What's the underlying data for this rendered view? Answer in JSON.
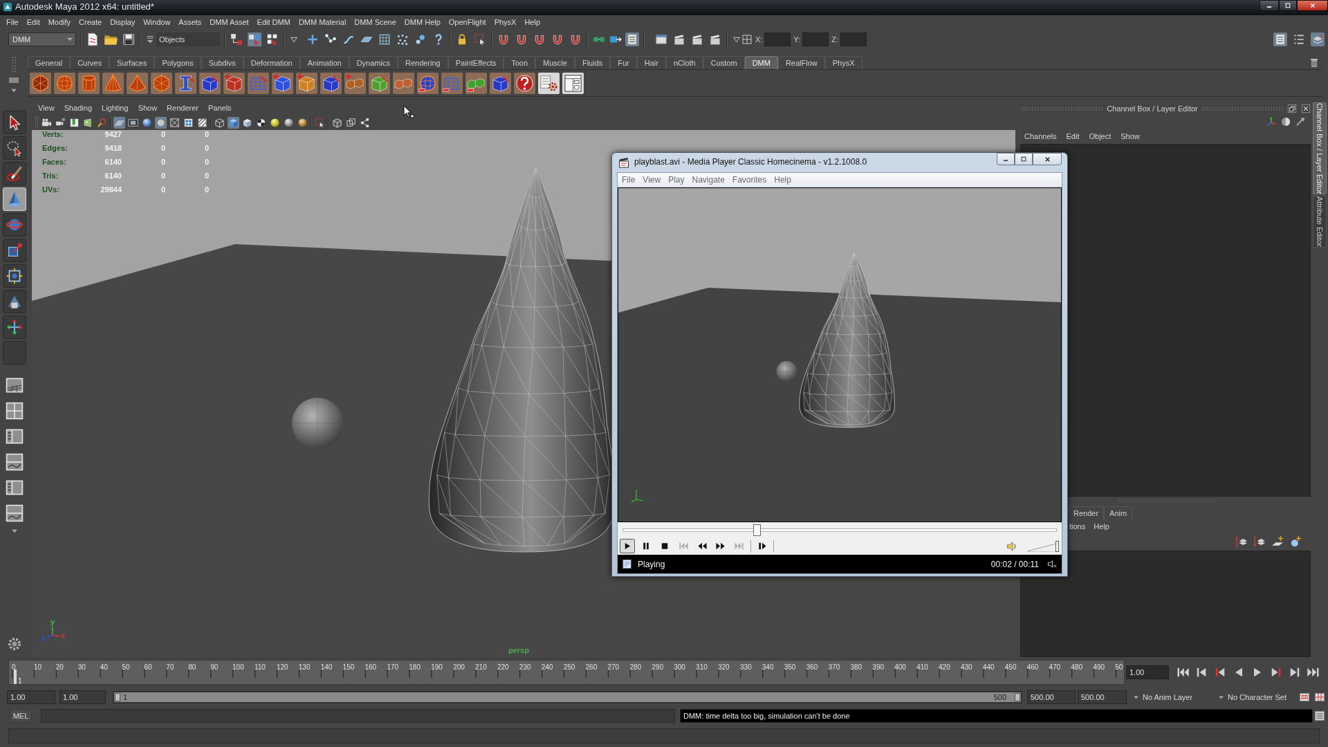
{
  "window": {
    "title": "Autodesk Maya 2012 x64: untitled*"
  },
  "menu_bar": [
    "File",
    "Edit",
    "Modify",
    "Create",
    "Display",
    "Window",
    "Assets",
    "DMM Asset",
    "Edit DMM",
    "DMM Material",
    "DMM Scene",
    "DMM Help",
    "OpenFlight",
    "PhysX",
    "Help"
  ],
  "status_line": {
    "menu_set": "DMM",
    "selection_mode": "Objects",
    "buttons": [
      {
        "on": false
      },
      {
        "on": true
      },
      {
        "on": false
      },
      {
        "on": false
      },
      {
        "on": false
      },
      {
        "on": false
      },
      {
        "on": false
      },
      {
        "on": false
      },
      {
        "on": false
      },
      {
        "on": false
      },
      {
        "on": false
      },
      {
        "on": false
      },
      {
        "on": false
      },
      {
        "on": false
      },
      {
        "on": false
      },
      {
        "on": false
      },
      {
        "on": false
      },
      {
        "on": false
      },
      {
        "on": false
      },
      {
        "on": false
      },
      {
        "on": true
      },
      {
        "on": false
      },
      {
        "on": false
      },
      {
        "on": false
      },
      {
        "on": false
      },
      {
        "on": true
      },
      {
        "on": false
      },
      {
        "on": true
      }
    ],
    "coordinate_fields": [
      "X:",
      "Y:",
      "Z:"
    ]
  },
  "shelf": {
    "tabs": [
      {
        "label": "General",
        "selected": false
      },
      {
        "label": "Curves",
        "selected": false
      },
      {
        "label": "Surfaces",
        "selected": false
      },
      {
        "label": "Polygons",
        "selected": false
      },
      {
        "label": "Subdivs",
        "selected": false
      },
      {
        "label": "Deformation",
        "selected": false
      },
      {
        "label": "Animation",
        "selected": false
      },
      {
        "label": "Dynamics",
        "selected": false
      },
      {
        "label": "Rendering",
        "selected": false
      },
      {
        "label": "PaintEffects",
        "selected": false
      },
      {
        "label": "Toon",
        "selected": false
      },
      {
        "label": "Muscle",
        "selected": false
      },
      {
        "label": "Fluids",
        "selected": false
      },
      {
        "label": "Fur",
        "selected": false
      },
      {
        "label": "Hair",
        "selected": false
      },
      {
        "label": "nCloth",
        "selected": false
      },
      {
        "label": "Custom",
        "selected": false
      },
      {
        "label": "DMM",
        "selected": true
      },
      {
        "label": "RealFlow",
        "selected": false
      },
      {
        "label": "PhysX",
        "selected": false
      }
    ]
  },
  "toolbox": {
    "tools": [
      {
        "selected": false
      },
      {
        "selected": false
      },
      {
        "selected": false
      },
      {
        "selected": true
      },
      {
        "selected": false
      },
      {
        "selected": false
      },
      {
        "selected": false
      },
      {
        "selected": false
      },
      {
        "selected": false
      }
    ]
  },
  "viewport": {
    "menu": [
      "View",
      "Shading",
      "Lighting",
      "Show",
      "Renderer",
      "Panels"
    ],
    "toolbar": [
      {
        "on": false
      },
      {
        "on": false
      },
      {
        "on": false
      },
      {
        "on": false
      },
      {
        "on": false
      },
      {
        "on": true
      },
      {
        "on": false
      },
      {
        "on": false
      },
      {
        "on": true
      },
      {
        "on": false
      },
      {
        "on": false
      },
      {
        "on": false
      },
      {
        "on": false
      },
      {
        "on": true
      },
      {
        "on": false
      },
      {
        "on": false
      },
      {
        "on": false
      },
      {
        "on": false
      },
      {
        "on": false
      },
      {
        "on": false
      },
      {
        "on": false
      },
      {
        "on": false
      },
      {
        "on": false
      }
    ],
    "hud": [
      {
        "label": "Verts:",
        "values": [
          "9427",
          "0",
          "0"
        ]
      },
      {
        "label": "Edges:",
        "values": [
          "9418",
          "0",
          "0"
        ]
      },
      {
        "label": "Faces:",
        "values": [
          "6140",
          "0",
          "0"
        ]
      },
      {
        "label": "Tris:",
        "values": [
          "6140",
          "0",
          "0"
        ]
      },
      {
        "label": "UVs:",
        "values": [
          "29844",
          "0",
          "0"
        ]
      }
    ],
    "axis_labels": [
      "y",
      "z",
      "x"
    ],
    "camera": "persp"
  },
  "channel_box": {
    "title": "Channel Box / Layer Editor",
    "menu": [
      "Channels",
      "Edit",
      "Object",
      "Show"
    ]
  },
  "layer_editor": {
    "tabs": [
      {
        "label": "Render",
        "selected": false
      },
      {
        "label": "Anim",
        "selected": false
      }
    ],
    "menu": [
      "tions",
      "Help"
    ]
  },
  "side_tabs": [
    {
      "label": "Channel Box / Layer Editor",
      "selected": true
    },
    {
      "label": "Attribute Editor",
      "selected": false
    }
  ],
  "time_slider": {
    "ticks": [
      "0",
      "10",
      "20",
      "30",
      "40",
      "50",
      "60",
      "70",
      "80",
      "90",
      "100",
      "110",
      "120",
      "130",
      "140",
      "150",
      "160",
      "170",
      "180",
      "190",
      "200",
      "210",
      "220",
      "230",
      "240",
      "250",
      "260",
      "270",
      "280",
      "290",
      "300",
      "310",
      "320",
      "330",
      "340",
      "350",
      "360",
      "370",
      "380",
      "390",
      "400",
      "410",
      "420",
      "430",
      "440",
      "450",
      "460",
      "470",
      "480",
      "490",
      "50"
    ],
    "level": 0.002,
    "current_frame": "1",
    "current_time": "1.00"
  },
  "range_slider": {
    "start_time": "1.00",
    "range_start": "1.00",
    "level": 1,
    "range_start_label": "1",
    "range_end_label": "500",
    "range_end": "500.00",
    "end_time": "500.00",
    "anim_layer": "No Anim Layer",
    "character_set": "No Character Set"
  },
  "command_line": {
    "language": "MEL",
    "result": "DMM: time delta too big, simulation can't be done"
  },
  "media_player": {
    "title": "playblast.avi - Media Player Classic Homecinema - v1.2.1008.0",
    "menu": [
      "File",
      "View",
      "Play",
      "Navigate",
      "Favorites",
      "Help"
    ],
    "seek": {
      "level": 0.31
    },
    "transport": [
      {
        "pressed": true,
        "disabled": false
      },
      {
        "pressed": false,
        "disabled": false
      },
      {
        "pressed": false,
        "disabled": false
      },
      {
        "pressed": false,
        "disabled": true
      },
      {
        "pressed": false,
        "disabled": false
      },
      {
        "pressed": false,
        "disabled": false
      },
      {
        "pressed": false,
        "disabled": true
      },
      {
        "pressed": false,
        "disabled": false
      }
    ],
    "volume": {
      "level": 1
    },
    "status": "Playing",
    "time": "00:02 / 00:11"
  }
}
